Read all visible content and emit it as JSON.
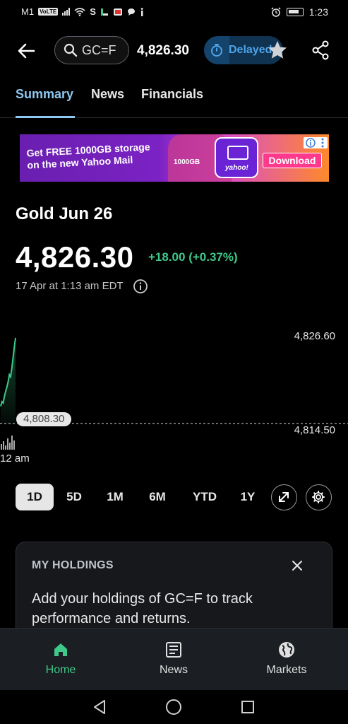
{
  "status_bar": {
    "carrier": "M1",
    "volte": "VoLTE",
    "extra": "S",
    "time": "1:23"
  },
  "header": {
    "search_text": "GC=F",
    "price": "4,826.30",
    "delayed_label": "Delayed"
  },
  "tabs": [
    {
      "label": "Summary",
      "active": true
    },
    {
      "label": "News",
      "active": false
    },
    {
      "label": "Financials",
      "active": false
    }
  ],
  "ad": {
    "line1": "Get FREE 1000GB storage",
    "line2": "on the new Yahoo Mail",
    "badge": "1000GB",
    "brand": "yahoo!",
    "cta": "Download"
  },
  "quote": {
    "name": "Gold Jun 26",
    "price": "4,826.30",
    "change": "+18.00 (+0.37%)",
    "as_of": "17 Apr at 1:13 am EDT",
    "colors": {
      "up": "#3ec98a",
      "accent": "#8ec8f0"
    }
  },
  "chart": {
    "high_label": "4,826.60",
    "low_label": "4,814.50",
    "prev_close_label": "4,808.30",
    "x_label": "12 am"
  },
  "chart_data": {
    "type": "area",
    "title": "",
    "xlabel": "",
    "ylabel": "",
    "ylim": [
      4814.5,
      4826.6
    ],
    "reference_line": 4808.3,
    "x": [
      0,
      1,
      2,
      3,
      4,
      5,
      6,
      7,
      8,
      9,
      10,
      11,
      12
    ],
    "values": [
      4817.0,
      4817.6,
      4817.4,
      4818.3,
      4819.0,
      4819.6,
      4820.3,
      4821.3,
      4821.0,
      4822.2,
      4823.6,
      4825.1,
      4826.3
    ],
    "color": "#3ec98a"
  },
  "ranges": [
    {
      "label": "1D",
      "active": true
    },
    {
      "label": "5D",
      "active": false
    },
    {
      "label": "1M",
      "active": false
    },
    {
      "label": "6M",
      "active": false
    },
    {
      "label": "YTD",
      "active": false
    },
    {
      "label": "1Y",
      "active": false
    }
  ],
  "holdings": {
    "title": "MY HOLDINGS",
    "body": "Add your holdings of GC=F to track performance and returns."
  },
  "bottom_nav": [
    {
      "label": "Home",
      "icon": "home-icon",
      "active": true
    },
    {
      "label": "News",
      "icon": "news-icon",
      "active": false
    },
    {
      "label": "Markets",
      "icon": "globe-icon",
      "active": false
    }
  ]
}
